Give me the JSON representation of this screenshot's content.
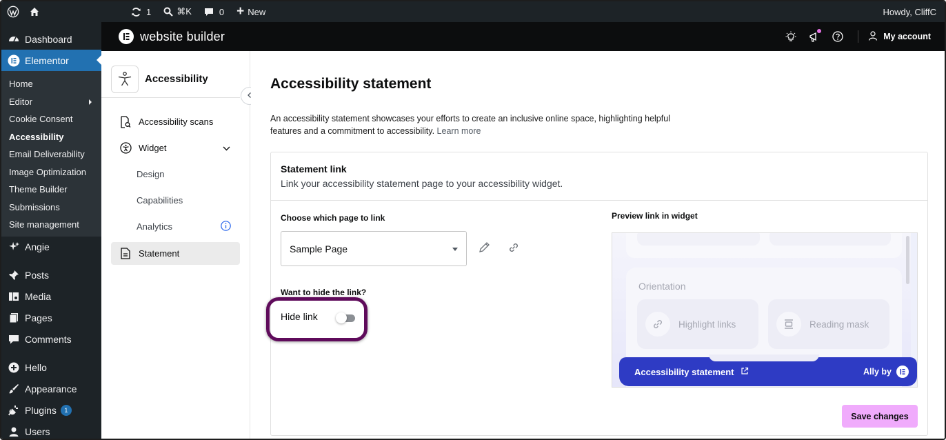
{
  "adminbar": {
    "updates_count": "1",
    "search_shortcut": "⌘K",
    "comments_count": "0",
    "new_label": "New",
    "greeting": "Howdy, CliffC"
  },
  "wpmenu": {
    "dashboard": "Dashboard",
    "elementor": "Elementor",
    "submenu": [
      "Home",
      "Editor",
      "Cookie Consent",
      "Accessibility",
      "Email Deliverability",
      "Image Optimization",
      "Theme Builder",
      "Submissions",
      "Site management"
    ],
    "angie": "Angie",
    "posts": "Posts",
    "media": "Media",
    "pages": "Pages",
    "comments": "Comments",
    "hello": "Hello",
    "appearance": "Appearance",
    "plugins": "Plugins",
    "plugins_badge": "1",
    "users": "Users"
  },
  "topbar": {
    "title": "website builder",
    "account": "My account"
  },
  "ally": {
    "name": "Accessibility",
    "nav": {
      "scans": "Accessibility scans",
      "widget": "Widget",
      "design": "Design",
      "capabilities": "Capabilities",
      "analytics": "Analytics",
      "statement": "Statement"
    }
  },
  "main": {
    "title": "Accessibility statement",
    "description": "An accessibility statement showcases your efforts to create an inclusive online space, highlighting helpful features and a commitment to accessibility.",
    "learn_more": "Learn more",
    "card": {
      "title": "Statement link",
      "subtitle": "Link your accessibility statement page to your accessibility widget.",
      "choose_label": "Choose which page to link",
      "selected_page": "Sample Page",
      "hide_question": "Want to hide the link?",
      "hide_label": "Hide link",
      "hide_enabled": false,
      "preview_label": "Preview link in widget",
      "preview": {
        "orientation": "Orientation",
        "option1": "Highlight links",
        "option2": "Reading mask",
        "statement_link": "Accessibility statement",
        "ally_by": "Ally by"
      },
      "save_label": "Save changes"
    }
  },
  "colors": {
    "wp_admin_bg": "#1d2327",
    "wp_active": "#2271b1",
    "highlight_ring": "#5f0b5b",
    "save_button": "#f0abfc",
    "widget_bar": "#2e3bc4"
  }
}
